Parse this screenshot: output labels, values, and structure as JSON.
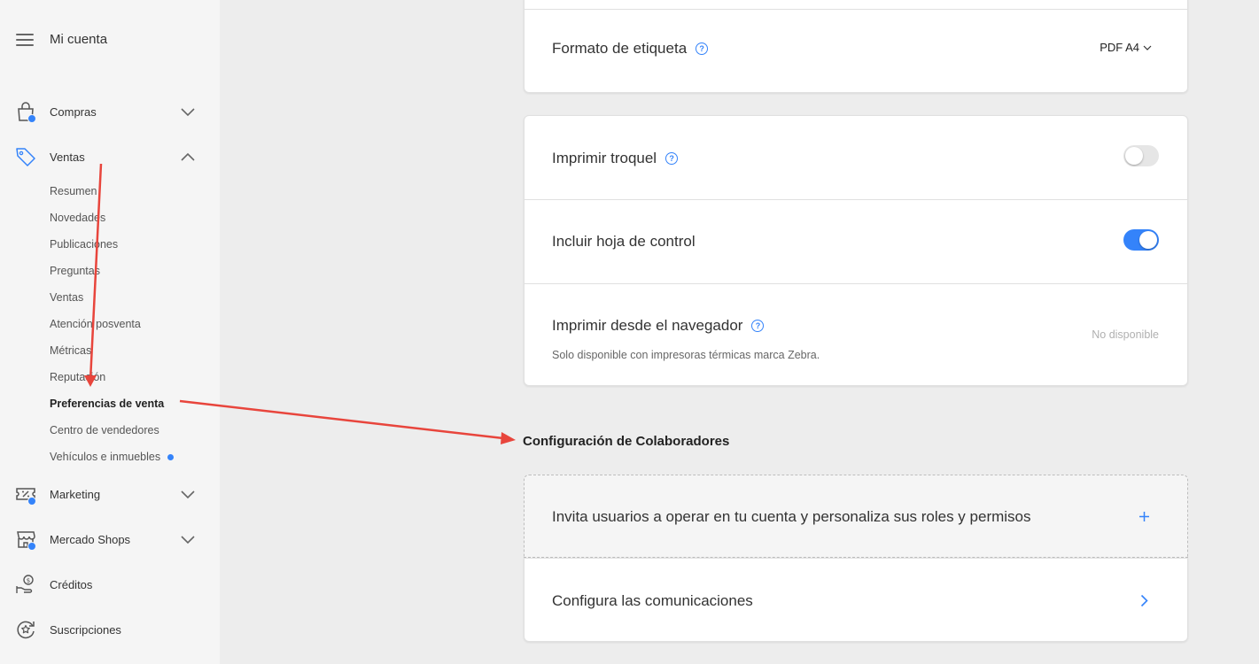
{
  "sidebar": {
    "title": "Mi cuenta",
    "items": {
      "compras": "Compras",
      "ventas": "Ventas",
      "marketing": "Marketing",
      "mercado_shops": "Mercado Shops",
      "creditos": "Créditos",
      "suscripciones": "Suscripciones"
    },
    "ventas_sub": {
      "resumen": "Resumen",
      "novedades": "Novedades",
      "publicaciones": "Publicaciones",
      "preguntas": "Preguntas",
      "ventas": "Ventas",
      "atencion": "Atención posventa",
      "metricas": "Métricas",
      "reputacion": "Reputación",
      "preferencias": "Preferencias de venta",
      "centro": "Centro de vendedores",
      "vehiculos": "Vehículos e inmuebles"
    }
  },
  "main": {
    "label_format": {
      "label": "Formato de etiqueta",
      "value": "PDF A4"
    },
    "print_die": {
      "label": "Imprimir troquel",
      "enabled": false
    },
    "control_sheet": {
      "label": "Incluir hoja de control",
      "enabled": true
    },
    "browser_print": {
      "label": "Imprimir desde el navegador",
      "description": "Solo disponible con impresoras térmicas marca Zebra.",
      "status": "No disponible"
    },
    "collab_section_title": "Configuración de Colaboradores",
    "invite_users": "Invita usuarios a operar en tu cuenta y personaliza sus roles y permisos",
    "configure_comms": "Configura las comunicaciones"
  },
  "colors": {
    "accent": "#3483fa",
    "annotation_arrow": "#e8453c"
  }
}
